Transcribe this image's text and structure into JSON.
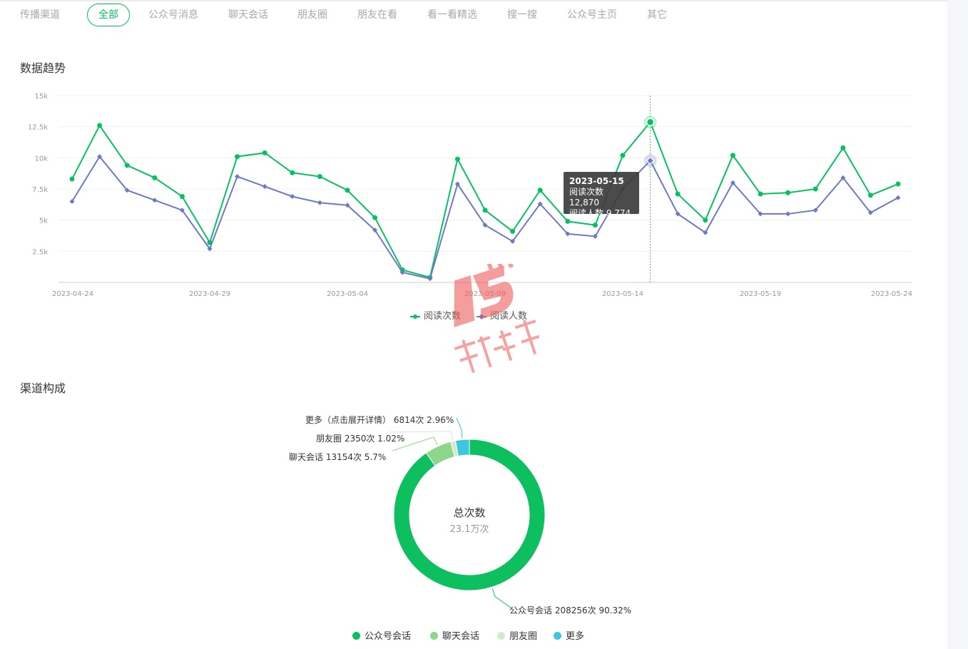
{
  "tabs": [
    {
      "label": "传播渠道",
      "active": false
    },
    {
      "label": "全部",
      "active": true
    },
    {
      "label": "公众号消息",
      "active": false
    },
    {
      "label": "聊天会话",
      "active": false
    },
    {
      "label": "朋友圈",
      "active": false
    },
    {
      "label": "朋友在看",
      "active": false
    },
    {
      "label": "看一看精选",
      "active": false
    },
    {
      "label": "搜一搜",
      "active": false
    },
    {
      "label": "公众号主页",
      "active": false
    },
    {
      "label": "其它",
      "active": false
    }
  ],
  "trend": {
    "title": "数据趋势",
    "tooltip": {
      "date": "2023-05-15",
      "line1": "阅读次数 12,870",
      "line2": "阅读人数 9,774"
    }
  },
  "channel": {
    "title": "渠道构成",
    "center_title": "总次数",
    "center_value": "23.1万次",
    "labels": {
      "more": "更多（点击展开详情） 6814次 2.96%",
      "moments": "朋友圈 2350次 1.02%",
      "chat": "聊天会话 13154次 5.7%",
      "official": "公众号会话 208256次 90.32%"
    },
    "legend": [
      "公众号会话",
      "聊天会话",
      "朋友圈",
      "更多"
    ]
  },
  "colors": {
    "accent": "#07c160",
    "read_count": "#07c160",
    "reader_count": "#6d79c4",
    "official": "#0dbf5e",
    "chat": "#8dd68a",
    "moments": "#cdeccb",
    "more": "#3ec5e0"
  },
  "chart_data": [
    {
      "type": "line",
      "title": "数据趋势",
      "xlabel": "",
      "ylabel": "",
      "ylim": [
        0,
        15000
      ],
      "yticks": [
        "2.5k",
        "5k",
        "7.5k",
        "10k",
        "12.5k",
        "15k"
      ],
      "xticks": [
        "2023-04-24",
        "2023-04-29",
        "2023-05-04",
        "2023-05-09",
        "2023-05-14",
        "2023-05-19",
        "2023-05-24"
      ],
      "x": [
        "2023-04-24",
        "2023-04-25",
        "2023-04-26",
        "2023-04-27",
        "2023-04-28",
        "2023-04-29",
        "2023-04-30",
        "2023-05-01",
        "2023-05-02",
        "2023-05-03",
        "2023-05-04",
        "2023-05-05",
        "2023-05-06",
        "2023-05-07",
        "2023-05-08",
        "2023-05-09",
        "2023-05-10",
        "2023-05-11",
        "2023-05-12",
        "2023-05-13",
        "2023-05-14",
        "2023-05-15",
        "2023-05-16",
        "2023-05-17",
        "2023-05-18",
        "2023-05-19",
        "2023-05-20",
        "2023-05-21",
        "2023-05-22",
        "2023-05-23",
        "2023-05-24"
      ],
      "series": [
        {
          "name": "阅读次数",
          "marker": "circle",
          "values": [
            8300,
            12600,
            9400,
            8400,
            6900,
            3200,
            10100,
            10400,
            8800,
            8500,
            7400,
            5200,
            1000,
            400,
            9900,
            5800,
            4100,
            7400,
            4900,
            4600,
            10200,
            12870,
            7100,
            5000,
            10200,
            7100,
            7200,
            7500,
            10800,
            7000,
            7900
          ]
        },
        {
          "name": "阅读人数",
          "marker": "diamond",
          "values": [
            6500,
            10100,
            7400,
            6600,
            5800,
            2700,
            8500,
            7700,
            6900,
            6400,
            6200,
            4200,
            800,
            300,
            7900,
            4600,
            3300,
            6300,
            3900,
            3700,
            7500,
            9774,
            5500,
            4000,
            8000,
            5500,
            5500,
            5800,
            8400,
            5600,
            6800
          ]
        }
      ],
      "grid": true,
      "legend": "bottom-center",
      "highlight": "2023-05-15"
    },
    {
      "type": "pie",
      "title": "渠道构成",
      "donut": true,
      "labels": [
        "公众号会话",
        "聊天会话",
        "朋友圈",
        "更多"
      ],
      "values": [
        208256,
        13154,
        2350,
        6814
      ],
      "percents": [
        90.32,
        5.7,
        1.02,
        2.96
      ],
      "legend": "bottom-center"
    }
  ]
}
